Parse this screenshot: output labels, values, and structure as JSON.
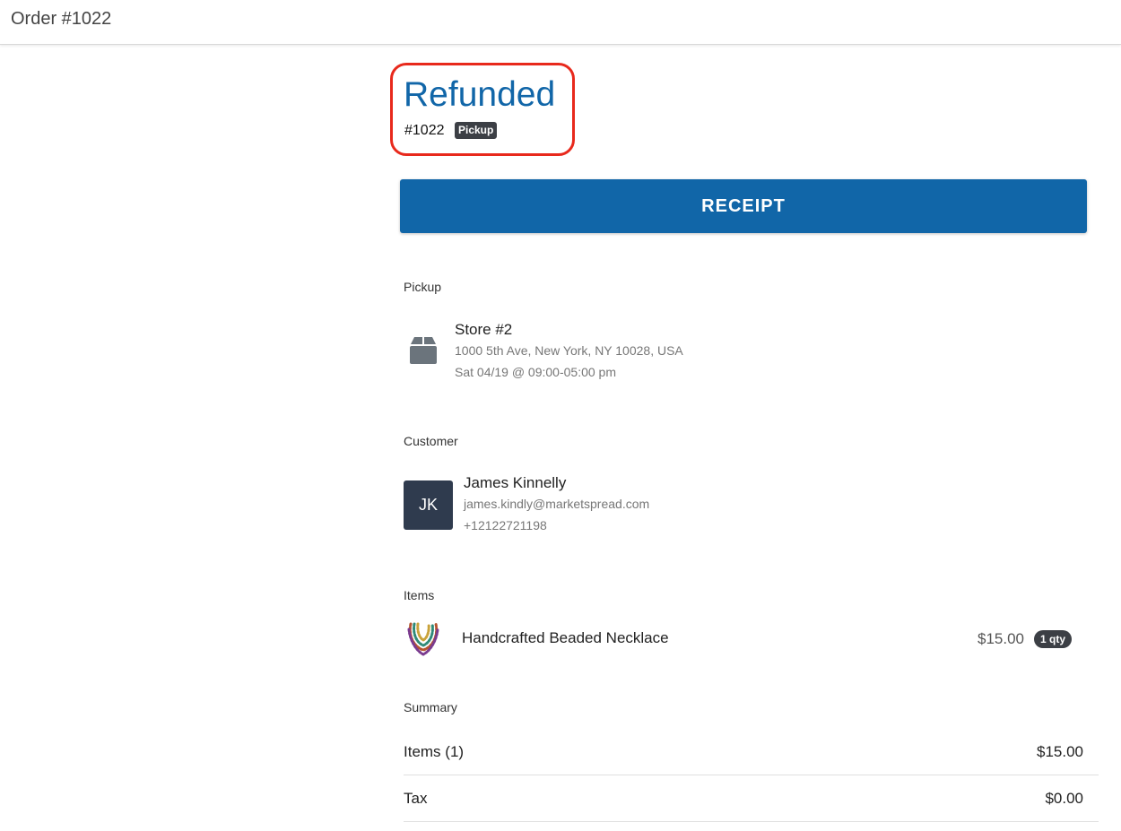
{
  "header": {
    "title": "Order #1022"
  },
  "status": {
    "title": "Refunded",
    "order_number": "#1022",
    "fulfillment_badge": "Pickup"
  },
  "actions": {
    "receipt_label": "RECEIPT"
  },
  "pickup": {
    "section_label": "Pickup",
    "icon": "store-box-icon",
    "store_name": "Store #2",
    "address": "1000 5th Ave, New York, NY 10028, USA",
    "schedule": "Sat 04/19 @ 09:00-05:00 pm"
  },
  "customer": {
    "section_label": "Customer",
    "initials": "JK",
    "name": "James Kinnelly",
    "email": "james.kindly@marketspread.com",
    "phone": "+12122721198"
  },
  "items": {
    "section_label": "Items",
    "list": [
      {
        "name": "Handcrafted Beaded Necklace",
        "price": "$15.00",
        "qty": "1 qty"
      }
    ]
  },
  "summary": {
    "section_label": "Summary",
    "rows": [
      {
        "label": "Items (1)",
        "value": "$15.00"
      },
      {
        "label": "Tax",
        "value": "$0.00"
      }
    ]
  },
  "colors": {
    "accent": "#1166a8",
    "highlight_border": "#e8291c",
    "badge_bg": "#3c3f45",
    "avatar_bg": "#2f3b4e"
  }
}
